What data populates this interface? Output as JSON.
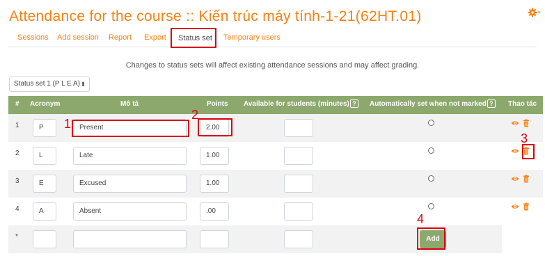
{
  "page": {
    "title": "Attendance for the course :: Kiến trúc máy tính-1-21(62HT.01)",
    "notice": "Changes to status sets will affect existing attendance sessions and may affect grading."
  },
  "settings": {
    "icon": "gear-icon",
    "caret": "▾"
  },
  "tabs": [
    {
      "label": "Sessions"
    },
    {
      "label": "Add session"
    },
    {
      "label": "Report"
    },
    {
      "label": "Export"
    },
    {
      "label": "Status set"
    },
    {
      "label": "Temporary users"
    }
  ],
  "status_select": {
    "value": "Status set 1 (P L E A)"
  },
  "table": {
    "headers": {
      "num": "#",
      "acronym": "Acronym",
      "description": "Mô tả",
      "points": "Points",
      "available": "Available for students (minutes)",
      "auto": "Automatically set when not marked",
      "actions": "Thao tác"
    },
    "help_glyph": "?",
    "rows": [
      {
        "num": "1",
        "acronym": "P",
        "description": "Present",
        "points": "2.00"
      },
      {
        "num": "2",
        "acronym": "L",
        "description": "Late",
        "points": "1.00"
      },
      {
        "num": "3",
        "acronym": "E",
        "description": "Excused",
        "points": "1.00"
      },
      {
        "num": "4",
        "acronym": "A",
        "description": "Absent",
        "points": ".00"
      }
    ],
    "new_row": {
      "num": "*",
      "add_label": "Add"
    }
  },
  "annotations": {
    "color": "#d9000d",
    "labels": [
      "1",
      "2",
      "3",
      "4"
    ]
  },
  "colors": {
    "accent": "#f98012",
    "header_bg": "#8ca86d"
  }
}
